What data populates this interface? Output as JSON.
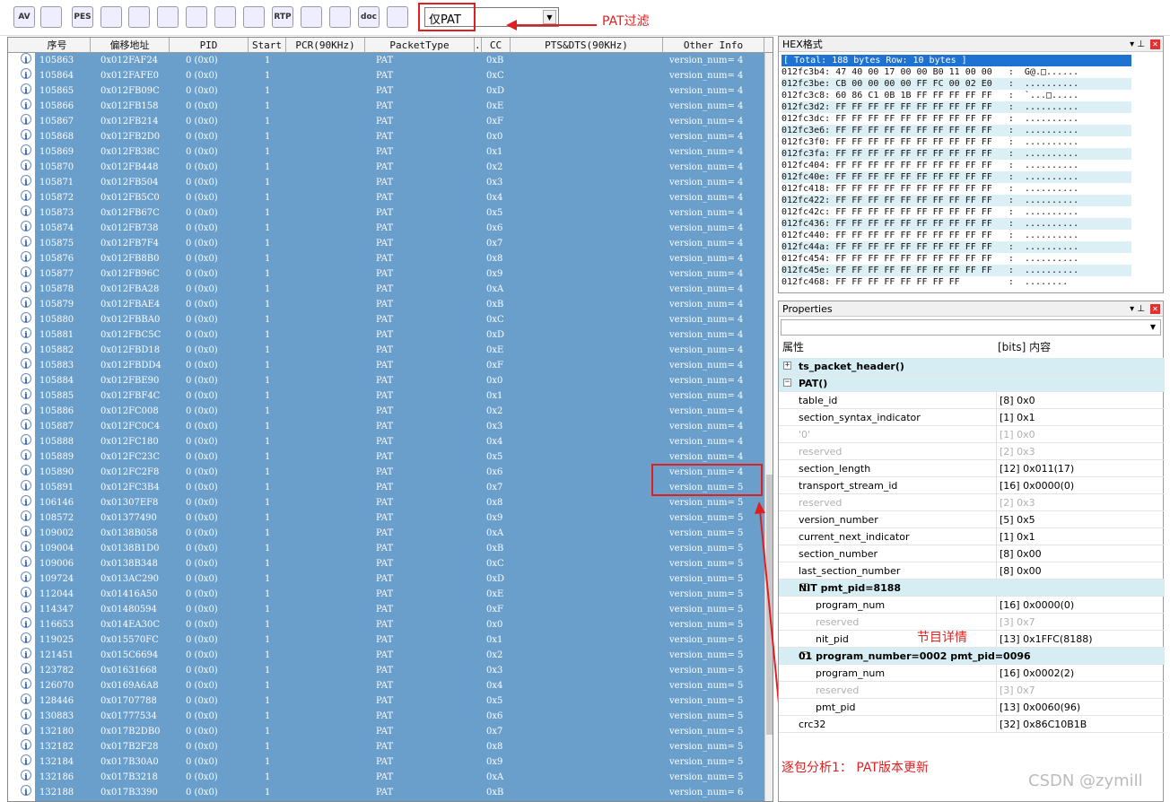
{
  "toolbar": {
    "icons": [
      "AV",
      "chart",
      "PES",
      "graph",
      "clock",
      "bars",
      "scope",
      "warn",
      "bits",
      "RTP",
      "export",
      "help",
      "doc",
      "stop"
    ],
    "filter_value": "仅PAT"
  },
  "annotations": {
    "filter_label": "PAT过滤",
    "detail_label": "节目详情",
    "analysis_label": "逐包分析1： PAT版本更新"
  },
  "list": {
    "columns": [
      "序号",
      "偏移地址",
      "PID",
      "Start",
      "PCR(90KHz)",
      "PacketType",
      "...",
      "CC",
      "PTS&DTS(90KHz)",
      "Other Info"
    ],
    "rows": [
      [
        "105863",
        "0x012FAF24",
        "0  (0x0)",
        "1",
        "PAT",
        "0xB",
        "version_num= 4"
      ],
      [
        "105864",
        "0x012FAFE0",
        "0  (0x0)",
        "1",
        "PAT",
        "0xC",
        "version_num= 4"
      ],
      [
        "105865",
        "0x012FB09C",
        "0  (0x0)",
        "1",
        "PAT",
        "0xD",
        "version_num= 4"
      ],
      [
        "105866",
        "0x012FB158",
        "0  (0x0)",
        "1",
        "PAT",
        "0xE",
        "version_num= 4"
      ],
      [
        "105867",
        "0x012FB214",
        "0  (0x0)",
        "1",
        "PAT",
        "0xF",
        "version_num= 4"
      ],
      [
        "105868",
        "0x012FB2D0",
        "0  (0x0)",
        "1",
        "PAT",
        "0x0",
        "version_num= 4"
      ],
      [
        "105869",
        "0x012FB38C",
        "0  (0x0)",
        "1",
        "PAT",
        "0x1",
        "version_num= 4"
      ],
      [
        "105870",
        "0x012FB448",
        "0  (0x0)",
        "1",
        "PAT",
        "0x2",
        "version_num= 4"
      ],
      [
        "105871",
        "0x012FB504",
        "0  (0x0)",
        "1",
        "PAT",
        "0x3",
        "version_num= 4"
      ],
      [
        "105872",
        "0x012FB5C0",
        "0  (0x0)",
        "1",
        "PAT",
        "0x4",
        "version_num= 4"
      ],
      [
        "105873",
        "0x012FB67C",
        "0  (0x0)",
        "1",
        "PAT",
        "0x5",
        "version_num= 4"
      ],
      [
        "105874",
        "0x012FB738",
        "0  (0x0)",
        "1",
        "PAT",
        "0x6",
        "version_num= 4"
      ],
      [
        "105875",
        "0x012FB7F4",
        "0  (0x0)",
        "1",
        "PAT",
        "0x7",
        "version_num= 4"
      ],
      [
        "105876",
        "0x012FB8B0",
        "0  (0x0)",
        "1",
        "PAT",
        "0x8",
        "version_num= 4"
      ],
      [
        "105877",
        "0x012FB96C",
        "0  (0x0)",
        "1",
        "PAT",
        "0x9",
        "version_num= 4"
      ],
      [
        "105878",
        "0x012FBA28",
        "0  (0x0)",
        "1",
        "PAT",
        "0xA",
        "version_num= 4"
      ],
      [
        "105879",
        "0x012FBAE4",
        "0  (0x0)",
        "1",
        "PAT",
        "0xB",
        "version_num= 4"
      ],
      [
        "105880",
        "0x012FBBA0",
        "0  (0x0)",
        "1",
        "PAT",
        "0xC",
        "version_num= 4"
      ],
      [
        "105881",
        "0x012FBC5C",
        "0  (0x0)",
        "1",
        "PAT",
        "0xD",
        "version_num= 4"
      ],
      [
        "105882",
        "0x012FBD18",
        "0  (0x0)",
        "1",
        "PAT",
        "0xE",
        "version_num= 4"
      ],
      [
        "105883",
        "0x012FBDD4",
        "0  (0x0)",
        "1",
        "PAT",
        "0xF",
        "version_num= 4"
      ],
      [
        "105884",
        "0x012FBE90",
        "0  (0x0)",
        "1",
        "PAT",
        "0x0",
        "version_num= 4"
      ],
      [
        "105885",
        "0x012FBF4C",
        "0  (0x0)",
        "1",
        "PAT",
        "0x1",
        "version_num= 4"
      ],
      [
        "105886",
        "0x012FC008",
        "0  (0x0)",
        "1",
        "PAT",
        "0x2",
        "version_num= 4"
      ],
      [
        "105887",
        "0x012FC0C4",
        "0  (0x0)",
        "1",
        "PAT",
        "0x3",
        "version_num= 4"
      ],
      [
        "105888",
        "0x012FC180",
        "0  (0x0)",
        "1",
        "PAT",
        "0x4",
        "version_num= 4"
      ],
      [
        "105889",
        "0x012FC23C",
        "0  (0x0)",
        "1",
        "PAT",
        "0x5",
        "version_num= 4"
      ],
      [
        "105890",
        "0x012FC2F8",
        "0  (0x0)",
        "1",
        "PAT",
        "0x6",
        "version_num= 4"
      ],
      [
        "105891",
        "0x012FC3B4",
        "0  (0x0)",
        "1",
        "PAT",
        "0x7",
        "version_num= 5"
      ],
      [
        "106146",
        "0x01307EF8",
        "0  (0x0)",
        "1",
        "PAT",
        "0x8",
        "version_num= 5"
      ],
      [
        "108572",
        "0x01377490",
        "0  (0x0)",
        "1",
        "PAT",
        "0x9",
        "version_num= 5"
      ],
      [
        "109002",
        "0x0138B058",
        "0  (0x0)",
        "1",
        "PAT",
        "0xA",
        "version_num= 5"
      ],
      [
        "109004",
        "0x0138B1D0",
        "0  (0x0)",
        "1",
        "PAT",
        "0xB",
        "version_num= 5"
      ],
      [
        "109006",
        "0x0138B348",
        "0  (0x0)",
        "1",
        "PAT",
        "0xC",
        "version_num= 5"
      ],
      [
        "109724",
        "0x013AC290",
        "0  (0x0)",
        "1",
        "PAT",
        "0xD",
        "version_num= 5"
      ],
      [
        "112044",
        "0x01416A50",
        "0  (0x0)",
        "1",
        "PAT",
        "0xE",
        "version_num= 5"
      ],
      [
        "114347",
        "0x01480594",
        "0  (0x0)",
        "1",
        "PAT",
        "0xF",
        "version_num= 5"
      ],
      [
        "116653",
        "0x014EA30C",
        "0  (0x0)",
        "1",
        "PAT",
        "0x0",
        "version_num= 5"
      ],
      [
        "119025",
        "0x015570FC",
        "0  (0x0)",
        "1",
        "PAT",
        "0x1",
        "version_num= 5"
      ],
      [
        "121451",
        "0x015C6694",
        "0  (0x0)",
        "1",
        "PAT",
        "0x2",
        "version_num= 5"
      ],
      [
        "123782",
        "0x01631668",
        "0  (0x0)",
        "1",
        "PAT",
        "0x3",
        "version_num= 5"
      ],
      [
        "126070",
        "0x0169A6A8",
        "0  (0x0)",
        "1",
        "PAT",
        "0x4",
        "version_num= 5"
      ],
      [
        "128446",
        "0x01707788",
        "0  (0x0)",
        "1",
        "PAT",
        "0x5",
        "version_num= 5"
      ],
      [
        "130883",
        "0x01777534",
        "0  (0x0)",
        "1",
        "PAT",
        "0x6",
        "version_num= 5"
      ],
      [
        "132180",
        "0x017B2DB0",
        "0  (0x0)",
        "1",
        "PAT",
        "0x7",
        "version_num= 5"
      ],
      [
        "132182",
        "0x017B2F28",
        "0  (0x0)",
        "1",
        "PAT",
        "0x8",
        "version_num= 5"
      ],
      [
        "132184",
        "0x017B30A0",
        "0  (0x0)",
        "1",
        "PAT",
        "0x9",
        "version_num= 5"
      ],
      [
        "132186",
        "0x017B3218",
        "0  (0x0)",
        "1",
        "PAT",
        "0xA",
        "version_num= 5"
      ],
      [
        "132188",
        "0x017B3390",
        "0  (0x0)",
        "1",
        "PAT",
        "0xB",
        "version_num= 6"
      ]
    ]
  },
  "hex": {
    "title": "HEX格式",
    "summary": "[ Total: 188 bytes  Row: 10 bytes ]",
    "lines": [
      "012fc3b4: 47 40 00 17 00 00 B0 11 00 00   :  G@.□......",
      "012fc3be: CB 00 00 00 00 FF FC 00 02 E0   :  ..........",
      "012fc3c8: 60 86 C1 0B 1B FF FF FF FF FF   :  `...□.....",
      "012fc3d2: FF FF FF FF FF FF FF FF FF FF   :  ..........",
      "012fc3dc: FF FF FF FF FF FF FF FF FF FF   :  ..........",
      "012fc3e6: FF FF FF FF FF FF FF FF FF FF   :  ..........",
      "012fc3f0: FF FF FF FF FF FF FF FF FF FF   :  ..........",
      "012fc3fa: FF FF FF FF FF FF FF FF FF FF   :  ..........",
      "012fc404: FF FF FF FF FF FF FF FF FF FF   :  ..........",
      "012fc40e: FF FF FF FF FF FF FF FF FF FF   :  ..........",
      "012fc418: FF FF FF FF FF FF FF FF FF FF   :  ..........",
      "012fc422: FF FF FF FF FF FF FF FF FF FF   :  ..........",
      "012fc42c: FF FF FF FF FF FF FF FF FF FF   :  ..........",
      "012fc436: FF FF FF FF FF FF FF FF FF FF   :  ..........",
      "012fc440: FF FF FF FF FF FF FF FF FF FF   :  ..........",
      "012fc44a: FF FF FF FF FF FF FF FF FF FF   :  ..........",
      "012fc454: FF FF FF FF FF FF FF FF FF FF   :  ..........",
      "012fc45e: FF FF FF FF FF FF FF FF FF FF   :  ..........",
      "012fc468: FF FF FF FF FF FF FF FF         :  ........"
    ]
  },
  "properties": {
    "title": "Properties",
    "col_attr": "属性",
    "col_value": "[bits] 内容",
    "rows": [
      {
        "k": "ts_packet_header()",
        "v": "",
        "level": 0,
        "group": true,
        "exp": "+"
      },
      {
        "k": "PAT()",
        "v": "",
        "level": 0,
        "group": true,
        "exp": "−"
      },
      {
        "k": "table_id",
        "v": "[8]  0x0",
        "level": 1
      },
      {
        "k": "section_syntax_indicator",
        "v": "[1]  0x1",
        "level": 1
      },
      {
        "k": "'0'",
        "v": "[1]  0x0",
        "level": 1,
        "dim": true
      },
      {
        "k": "reserved",
        "v": "[2]  0x3",
        "level": 1,
        "dim": true
      },
      {
        "k": "section_length",
        "v": "[12] 0x011(17)",
        "level": 1
      },
      {
        "k": "transport_stream_id",
        "v": "[16] 0x0000(0)",
        "level": 1
      },
      {
        "k": "reserved",
        "v": "[2]  0x3",
        "level": 1,
        "dim": true
      },
      {
        "k": "version_number",
        "v": "[5]  0x5",
        "level": 1
      },
      {
        "k": "current_next_indicator",
        "v": "[1]  0x1",
        "level": 1
      },
      {
        "k": "section_number",
        "v": "[8]  0x00",
        "level": 1
      },
      {
        "k": "last_section_number",
        "v": "[8]  0x00",
        "level": 1
      },
      {
        "k": "NIT pmt_pid=8188",
        "v": "",
        "level": 1,
        "group": true,
        "exp": "−"
      },
      {
        "k": "program_num",
        "v": "[16] 0x0000(0)",
        "level": 2
      },
      {
        "k": "reserved",
        "v": "[3]  0x7",
        "level": 2,
        "dim": true
      },
      {
        "k": "nit_pid",
        "v": "[13] 0x1FFC(8188)",
        "level": 2
      },
      {
        "k": "01 program_number=0002 pmt_pid=0096",
        "v": "",
        "level": 1,
        "group": true,
        "exp": "−"
      },
      {
        "k": "program_num",
        "v": "[16] 0x0002(2)",
        "level": 2
      },
      {
        "k": "reserved",
        "v": "[3]  0x7",
        "level": 2,
        "dim": true
      },
      {
        "k": "pmt_pid",
        "v": "[13] 0x0060(96)",
        "level": 2
      },
      {
        "k": "crc32",
        "v": "[32] 0x86C10B1B",
        "level": 1
      }
    ]
  },
  "watermark": "CSDN @zymill"
}
